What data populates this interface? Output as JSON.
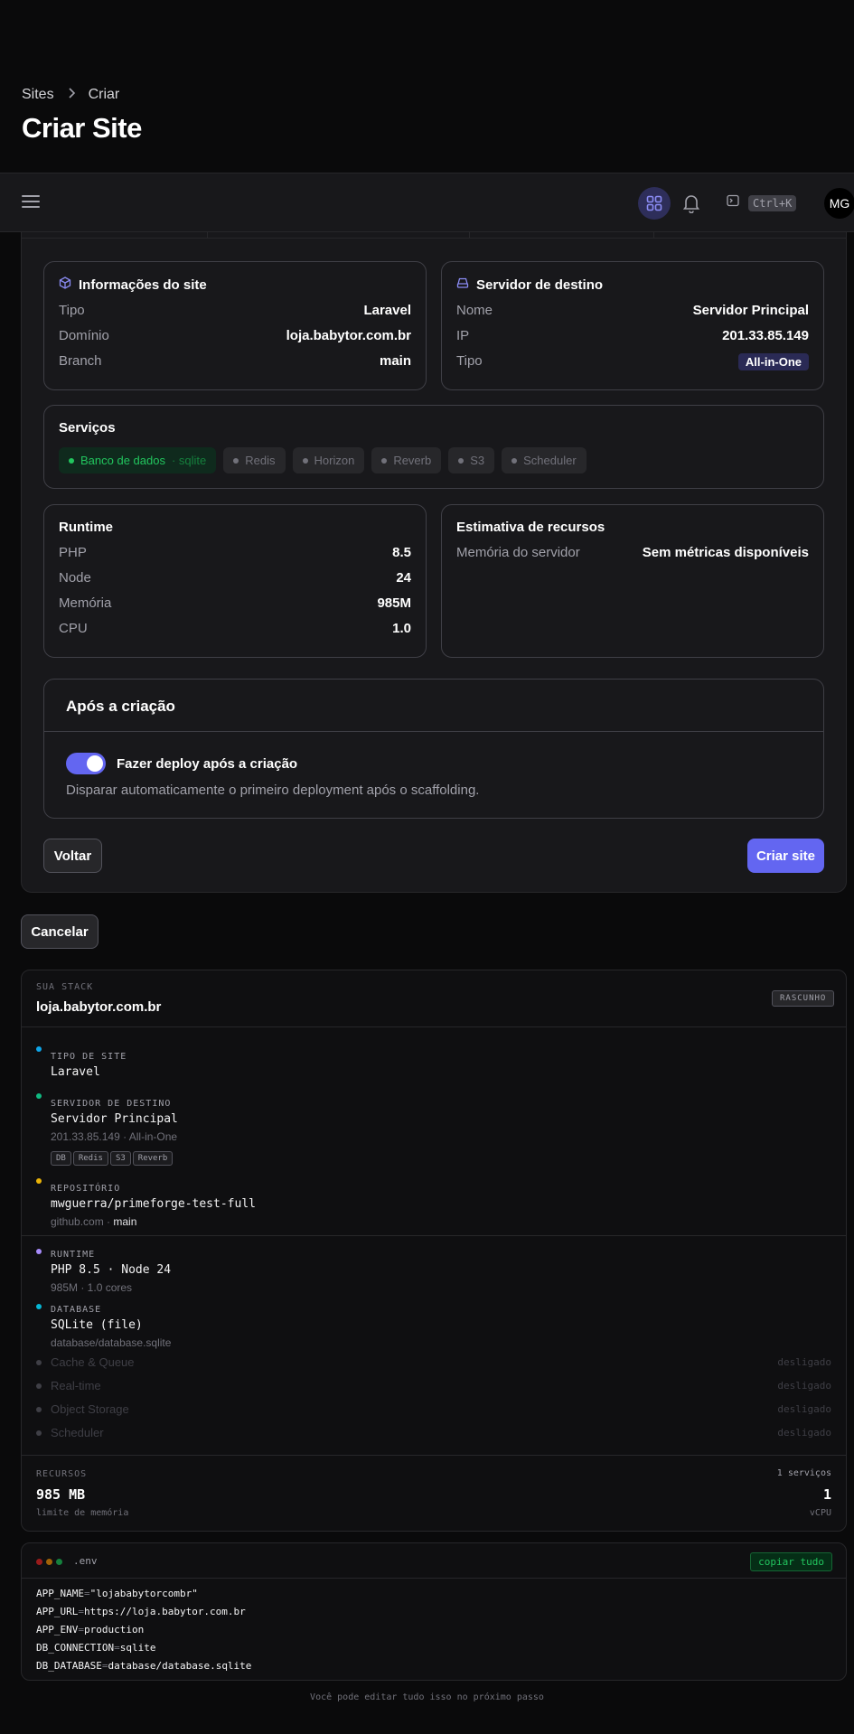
{
  "breadcrumb": {
    "parent": "Sites",
    "current": "Criar"
  },
  "page_title": "Criar Site",
  "topbar": {
    "shortcut": "Ctrl+K",
    "avatar_initials": "MG"
  },
  "site_info": {
    "title": "Informações do site",
    "rows": [
      {
        "k": "Tipo",
        "v": "Laravel"
      },
      {
        "k": "Domínio",
        "v": "loja.babytor.com.br"
      },
      {
        "k": "Branch",
        "v": "main"
      }
    ]
  },
  "target_server": {
    "title": "Servidor de destino",
    "rows": [
      {
        "k": "Nome",
        "v": "Servidor Principal"
      },
      {
        "k": "IP",
        "v": "201.33.85.149"
      },
      {
        "k": "Tipo",
        "v": "All-in-One"
      }
    ]
  },
  "services": {
    "title": "Serviços",
    "items": [
      {
        "label": "Banco de dados",
        "sub": "· sqlite",
        "active": true
      },
      {
        "label": "Redis",
        "active": false
      },
      {
        "label": "Horizon",
        "active": false
      },
      {
        "label": "Reverb",
        "active": false
      },
      {
        "label": "S3",
        "active": false
      },
      {
        "label": "Scheduler",
        "active": false
      }
    ]
  },
  "runtime": {
    "title": "Runtime",
    "rows": [
      {
        "k": "PHP",
        "v": "8.5"
      },
      {
        "k": "Node",
        "v": "24"
      },
      {
        "k": "Memória",
        "v": "985M"
      },
      {
        "k": "CPU",
        "v": "1.0"
      }
    ]
  },
  "estimate": {
    "title": "Estimativa de recursos",
    "rows": [
      {
        "k": "Memória do servidor",
        "v": "Sem métricas disponíveis"
      }
    ]
  },
  "after_creation": {
    "title": "Após a criação",
    "toggle_label": "Fazer deploy após a criação",
    "toggle_on": true,
    "description": "Disparar automaticamente o primeiro deployment após o scaffolding."
  },
  "buttons": {
    "back": "Voltar",
    "create": "Criar site",
    "cancel": "Cancelar"
  },
  "stack": {
    "eyebrow": "SUA STACK",
    "domain": "loja.babytor.com.br",
    "badge": "RASCUNHO",
    "site_type": {
      "label": "TIPO DE SITE",
      "value": "Laravel",
      "color": "#0ea5e9"
    },
    "server": {
      "label": "SERVIDOR DE DESTINO",
      "value": "Servidor Principal",
      "sub": "201.33.85.149 · All-in-One",
      "chips": [
        "DB",
        "Redis",
        "S3",
        "Reverb"
      ],
      "color": "#10b981"
    },
    "repo": {
      "label": "REPOSITÓRIO",
      "value": "mwguerra/primeforge-test-full",
      "sub_host": "github.com · ",
      "sub_branch": "main",
      "color": "#eab308"
    },
    "runtime": {
      "label": "RUNTIME",
      "value": "PHP 8.5 · Node 24",
      "sub": "985M · 1.0 cores",
      "color": "#a78bfa"
    },
    "database": {
      "label": "DATABASE",
      "value": "SQLite (file)",
      "sub": "database/database.sqlite",
      "color": "#06b6d4"
    },
    "disabled": [
      {
        "name": "Cache & Queue",
        "state": "desligado"
      },
      {
        "name": "Real-time",
        "state": "desligado"
      },
      {
        "name": "Object Storage",
        "state": "desligado"
      },
      {
        "name": "Scheduler",
        "state": "desligado"
      }
    ],
    "resources": {
      "label": "RECURSOS",
      "services_count": "1 serviços",
      "memory": "985 MB",
      "memory_label": "limite de memória",
      "vcpu": "1",
      "vcpu_label": "vCPU"
    }
  },
  "env": {
    "filename": ".env",
    "copy_label": "copiar tudo",
    "lines": [
      {
        "key": "APP_NAME",
        "value": "\"lojababytorcombr\""
      },
      {
        "key": "APP_URL",
        "value": "https://loja.babytor.com.br"
      },
      {
        "key": "APP_ENV",
        "value": "production"
      },
      {
        "key": "DB_CONNECTION",
        "value": "sqlite"
      },
      {
        "key": "DB_DATABASE",
        "value": "database/database.sqlite"
      }
    ]
  },
  "footer_note": "Você pode editar tudo isso no próximo passo",
  "colors": {
    "accent": "#6366f1",
    "success": "#22c55e",
    "background": "#0a0a0b",
    "surface": "#18181b"
  }
}
